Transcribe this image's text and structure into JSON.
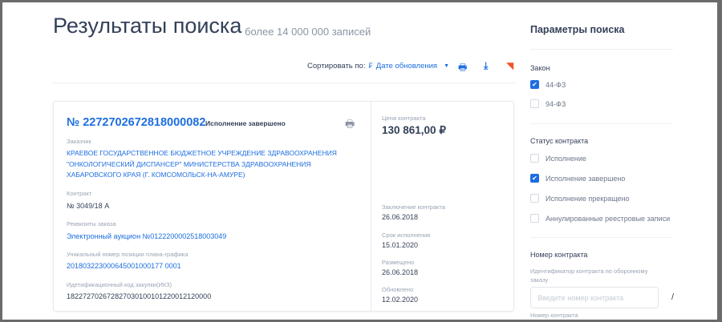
{
  "header": {
    "title": "Результаты поиска",
    "count": "более 14 000 000 записей"
  },
  "sort": {
    "label": "Сортировать по:",
    "value": "Дате обновления"
  },
  "result": {
    "number": "№ 2272702672818000082",
    "status": "Исполнение завершено",
    "customer_label": "Заказчик",
    "customer": "КРАЕВОЕ ГОСУДАРСТВЕННОЕ БЮДЖЕТНОЕ УЧРЕЖДЕНИЕ ЗДРАВООХРАНЕНИЯ \"ОНКОЛОГИЧЕСКИЙ ДИСПАНСЕР\" МИНИСТЕРСТВА ЗДРАВООХРАНЕНИЯ ХАБАРОВСКОГО КРАЯ (Г. КОМСОМОЛЬСК-НА-АМУРЕ)",
    "contract_label": "Контракт",
    "contract": "№ 3049/18 А",
    "order_label": "Реквизиты заказа",
    "order": "Электронный аукцион №0122200002518003049",
    "plan_label": "Уникальный номер позиции плана-графика",
    "plan": "201803223000645001000177 0001",
    "ikz_label": "Идетификационный код закупки(ИКЗ)",
    "ikz": "182272702672827030100101220012120000",
    "price_label": "Цена контракта",
    "price": "130 861,00 ₽",
    "dates": [
      {
        "label": "Заключение контракта",
        "value": "26.06.2018"
      },
      {
        "label": "Срок исполнения",
        "value": "15.01.2020"
      },
      {
        "label": "Размещено",
        "value": "26.06.2018"
      },
      {
        "label": "Обновлено",
        "value": "12.02.2020"
      }
    ]
  },
  "sidebar": {
    "title": "Параметры поиска",
    "law_title": "Закон",
    "laws": [
      {
        "label": "44-ФЗ",
        "checked": true
      },
      {
        "label": "94-ФЗ",
        "checked": false
      }
    ],
    "status_title": "Статус контракта",
    "statuses": [
      {
        "label": "Исполнение",
        "checked": false
      },
      {
        "label": "Исполнение завершено",
        "checked": true
      },
      {
        "label": "Исполнение прекращено",
        "checked": false
      },
      {
        "label": "Аннулированные реестровые записи",
        "checked": false
      }
    ],
    "number_title": "Номер контракта",
    "number_hint": "Идентификатор контракта по оборонному заказу",
    "number_placeholder": "Введите номер контракта",
    "separator": "/",
    "number_label2": "Номер контракта"
  }
}
